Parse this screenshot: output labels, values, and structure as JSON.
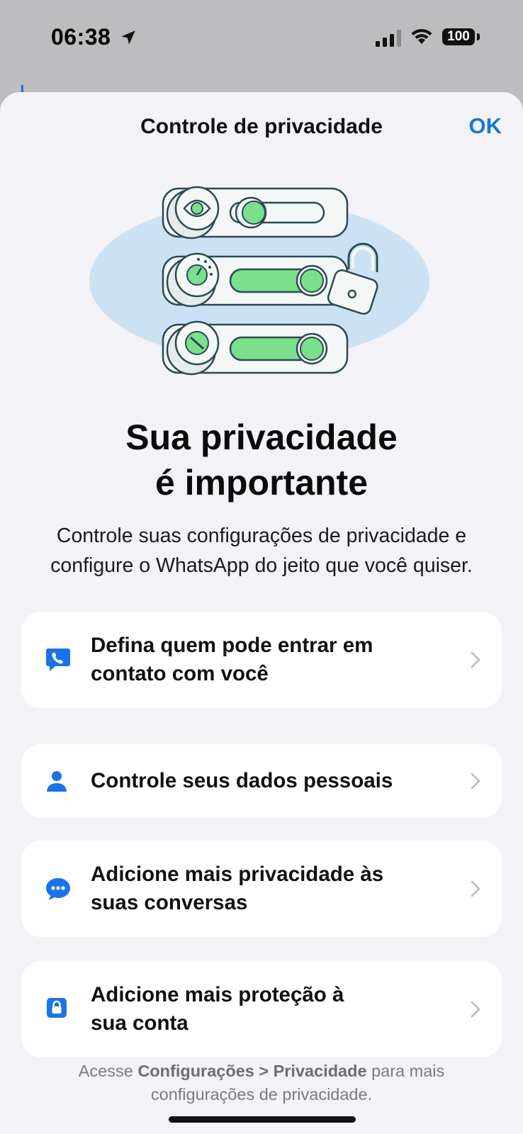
{
  "status_bar": {
    "time": "06:38",
    "battery": "100",
    "location_icon": "location-arrow-icon",
    "signal_icon": "cellular-signal-icon",
    "wifi_icon": "wifi-icon"
  },
  "header": {
    "title": "Controle de privacidade",
    "ok_label": "OK"
  },
  "hero": {
    "illustration": "privacy-toggles-illustration",
    "headline_line1": "Sua privacidade",
    "headline_line2": "é importante",
    "subtitle": "Controle suas configurações de privacidade e configure o WhatsApp do jeito que você quiser."
  },
  "options": [
    {
      "icon": "phone-bubble-icon",
      "label_line1": "Defina quem pode entrar em",
      "label_line2": "contato com você"
    },
    {
      "icon": "person-icon",
      "label_line1": "Controle seus dados pessoais",
      "label_line2": ""
    },
    {
      "icon": "chat-bubble-icon",
      "label_line1": "Adicione mais privacidade às",
      "label_line2": "suas conversas"
    },
    {
      "icon": "lock-icon",
      "label_line1": "Adicione mais proteção à",
      "label_line2": "sua conta"
    }
  ],
  "footer": {
    "prefix": "Acesse ",
    "bold1": "Configurações > Privacidade",
    "suffix": " para mais configurações de privacidade."
  },
  "colors": {
    "accent": "#1877d2",
    "icon_blue": "#1a73e8",
    "sheet_bg": "#f2f2f7",
    "toggle_green": "#7ae08c"
  }
}
